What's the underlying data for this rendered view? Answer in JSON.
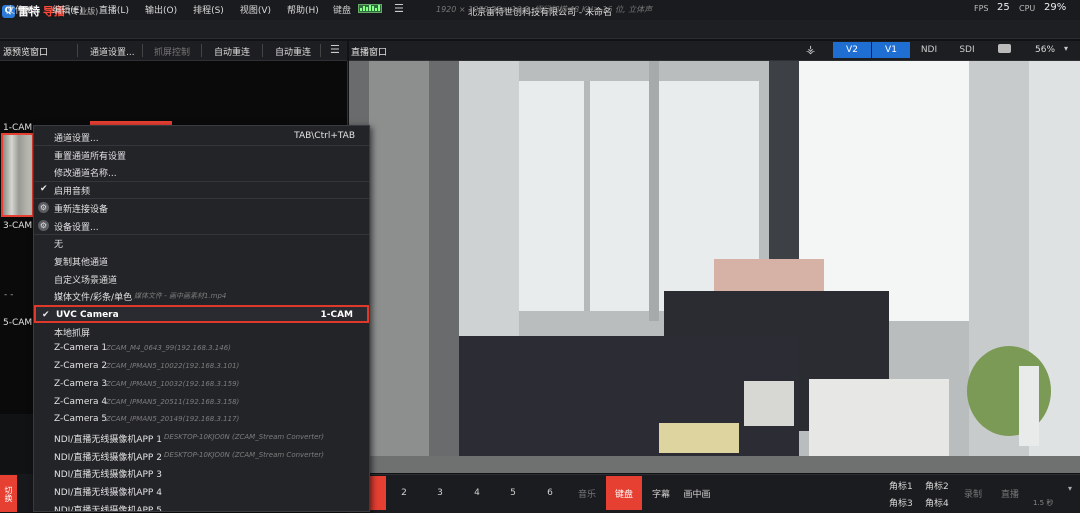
{
  "app": {
    "brand_a": "雷特",
    "brand_b": "导播",
    "edition": "(专业版)",
    "window_title": "北京雷特世创科技有限公司 - 未命名"
  },
  "menu": [
    "文件(F)",
    "编辑(E)",
    "直播(L)",
    "输出(O)",
    "排程(S)",
    "视图(V)",
    "帮助(H)"
  ],
  "status": {
    "keyboard_label": "键盘",
    "video_format": "1920 × 1080 25p, 16:9, 逐行扫描 48 KHz, 16 位, 立体声",
    "fps_label": "FPS",
    "fps_value": "25",
    "cpu_label": "CPU",
    "cpu_value": "29%"
  },
  "preview": {
    "title": "源预览窗口",
    "btn_channel_settings": "通道设置...",
    "btn_grab_control": "抓屏控制",
    "btn_auto_switch_1": "自动重连",
    "btn_auto_switch_2": "自动重连",
    "cams": [
      "1-CAM",
      "3-CAM",
      "5-CAM"
    ],
    "dashes": "- -"
  },
  "program": {
    "title": "直播窗口",
    "outputs": [
      "V2",
      "V1",
      "NDI",
      "SDI"
    ],
    "active_outputs": [
      "V2",
      "V1"
    ],
    "zoom": "56%"
  },
  "bottom": {
    "left_red_tab": "切换",
    "numbers": [
      "2",
      "3",
      "4",
      "5",
      "6"
    ],
    "music": "音乐",
    "keyboard": "键盘",
    "subtitle": "字幕",
    "pip": "画中画",
    "logo1": "角标1",
    "logo2": "角标2",
    "logo3": "角标3",
    "logo4": "角标4",
    "record": "录制",
    "live": "直播",
    "speed": "1.5 秒"
  },
  "context_menu": {
    "items": [
      {
        "label": "通道设置...",
        "shortcut": "TAB\\Ctrl+TAB"
      },
      {
        "label": "重置通道所有设置"
      },
      {
        "label": "修改通道名称..."
      },
      {
        "label": "启用音频",
        "checked": true
      },
      {
        "label": "重新连接设备",
        "icon": true
      },
      {
        "label": "设备设置...",
        "icon": true
      },
      {
        "label": "无"
      },
      {
        "label": "复制其他通道"
      },
      {
        "label": "自定义场景通道"
      },
      {
        "label": "媒体文件/彩条/单色",
        "sub": "媒体文件 - 画中画素材1.mp4"
      },
      {
        "label": "UVC Camera",
        "shortcut": "1-CAM",
        "checked": true,
        "selected": true
      },
      {
        "label": "本地抓屏"
      },
      {
        "label": "Z-Camera 1",
        "sub": "ZCAM_M4_0643_99(192.168.3.146)"
      },
      {
        "label": "Z-Camera 2",
        "sub": "ZCAM_IPMAN5_10022(192.168.3.101)"
      },
      {
        "label": "Z-Camera 3",
        "sub": "ZCAM_IPMAN5_10032(192.168.3.159)"
      },
      {
        "label": "Z-Camera 4",
        "sub": "ZCAM_IPMAN5_20511(192.168.3.158)"
      },
      {
        "label": "Z-Camera 5",
        "sub": "ZCAM_IPMAN5_20149(192.168.3.117)"
      },
      {
        "label": "NDI/直播无线摄像机APP 1",
        "sub": "DESKTOP-10KJO0N (ZCAM_Stream Converter)"
      },
      {
        "label": "NDI/直播无线摄像机APP 2",
        "sub": "DESKTOP-10KJO0N (ZCAM_Stream Converter)"
      },
      {
        "label": "NDI/直播无线摄像机APP 3"
      },
      {
        "label": "NDI/直播无线摄像机APP 4"
      },
      {
        "label": "NDI/直播无线摄像机APP 5"
      }
    ]
  },
  "colors": {
    "accent_red": "#e64032",
    "accent_blue": "#1e6fd1"
  }
}
